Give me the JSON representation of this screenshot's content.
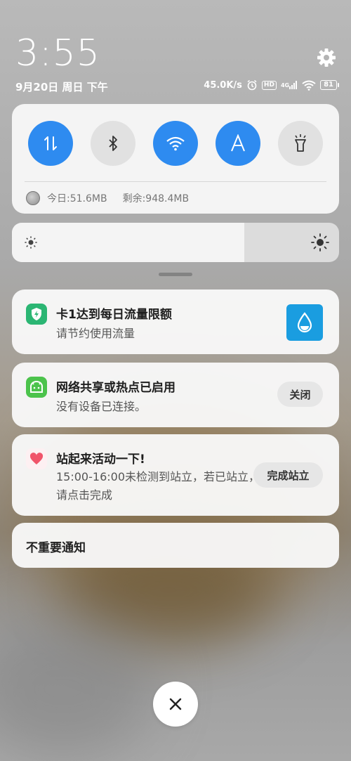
{
  "header": {
    "time": "3:55",
    "date": "9月20日 周日 下午",
    "network_speed": "45.0K/s",
    "hd_label": "HD",
    "signal_label": "4G",
    "battery": "81",
    "icons": [
      "alarm-icon",
      "hd-icon",
      "signal-4g-icon",
      "wifi-icon",
      "battery-icon",
      "gear-icon"
    ]
  },
  "quick_settings": {
    "toggles": [
      {
        "name": "mobile-data",
        "icon": "data-transfer-icon",
        "state": "on"
      },
      {
        "name": "bluetooth",
        "icon": "bluetooth-icon",
        "state": "off"
      },
      {
        "name": "wifi",
        "icon": "wifi-icon",
        "state": "on"
      },
      {
        "name": "auto-brightness",
        "icon": "letter-a-icon",
        "state": "on"
      },
      {
        "name": "flashlight",
        "icon": "flashlight-icon",
        "state": "off"
      }
    ],
    "usage_today": "今日:51.6MB",
    "usage_remaining": "剩余:948.4MB"
  },
  "brightness": {
    "level": 0.71
  },
  "notifications": [
    {
      "title": "卡1达到每日流量限额",
      "text": "请节约使用流量",
      "icon": "shield-bolt-icon",
      "action_icon": "water-drop-icon"
    },
    {
      "title": "网络共享或热点已启用",
      "text": "没有设备已连接。",
      "icon": "android-icon",
      "action": "关闭"
    },
    {
      "title": "站起来活动一下!",
      "text": "15:00-16:00未检测到站立，若已站立，请点击完成",
      "icon": "heart-icon",
      "action": "完成站立"
    }
  ],
  "minor_notifications": "不重要通知",
  "colors": {
    "accent": "#2e8bf0",
    "traffic_icon": "#2bb673",
    "hotspot_icon": "#4cc34c",
    "heart": "#f0546a",
    "drop_button": "#1a9de0"
  }
}
